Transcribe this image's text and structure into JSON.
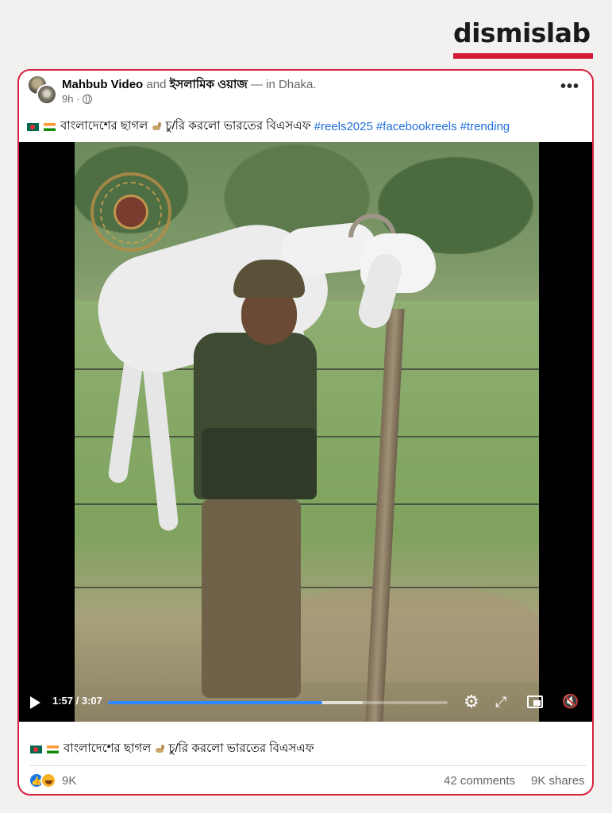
{
  "brand": {
    "logo_text": "dismislab",
    "accent_color": "#d51a34"
  },
  "post": {
    "author": "Mahbub Video",
    "connector": "and",
    "coauthor": "ইসলামিক ওয়াজ",
    "location": "— in Dhaka.",
    "time": "9h ·",
    "more_label": "•••",
    "caption_text": "বাংলাদেশের ছাগল",
    "caption_text2": "চু/রি করলো ভারতের বিএসএফ",
    "hashtags": [
      "#reels2025",
      "#facebookreels",
      "#trending"
    ]
  },
  "video": {
    "time": "1:57 / 3:07",
    "progress_fraction": 0.63,
    "buffer_fraction": 0.75,
    "watermark_icon": "tactical-media-badge-icon"
  },
  "footer": {
    "caption_text": "বাংলাদেশের ছাগল",
    "caption_text2": "চু/রি করলো ভারতের বিএসএফ",
    "reaction_count": "9K",
    "comments": "42 comments",
    "shares": "9K shares"
  }
}
